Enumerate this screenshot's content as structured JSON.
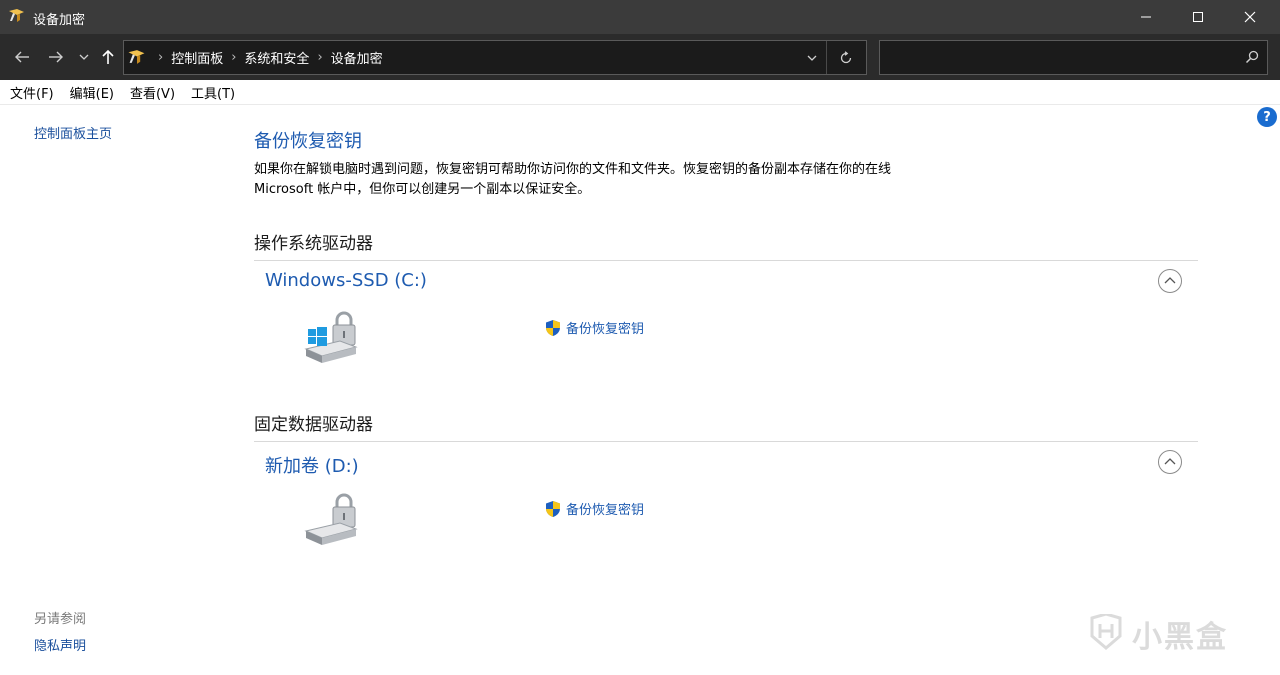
{
  "window": {
    "title": "设备加密",
    "icon": "control-panel-icon"
  },
  "address": {
    "breadcrumbs": [
      "控制面板",
      "系统和安全",
      "设备加密"
    ],
    "search_placeholder": ""
  },
  "menu": {
    "items": [
      "文件(F)",
      "编辑(E)",
      "查看(V)",
      "工具(T)"
    ]
  },
  "sidebar": {
    "home_link": "控制面板主页",
    "see_also_label": "另请参阅",
    "privacy_link": "隐私声明"
  },
  "main": {
    "title": "备份恢复密钥",
    "description": "如果你在解锁电脑时遇到问题，恢复密钥可帮助你访问你的文件和文件夹。恢复密钥的备份副本存储在你的在线 Microsoft 帐户中，但你可以创建另一个副本以保证安全。",
    "sections": [
      {
        "heading": "操作系统驱动器",
        "drive_name": "Windows-SSD (C:)",
        "action_label": "备份恢复密钥"
      },
      {
        "heading": "固定数据驱动器",
        "drive_name": "新加卷 (D:)",
        "action_label": "备份恢复密钥"
      }
    ]
  },
  "watermark": {
    "text": "小黑盒"
  },
  "colors": {
    "titlebar": "#3b3b3b",
    "navbar": "#2b2b2b",
    "link": "#1e5bb0",
    "help": "#1a6ccf"
  }
}
